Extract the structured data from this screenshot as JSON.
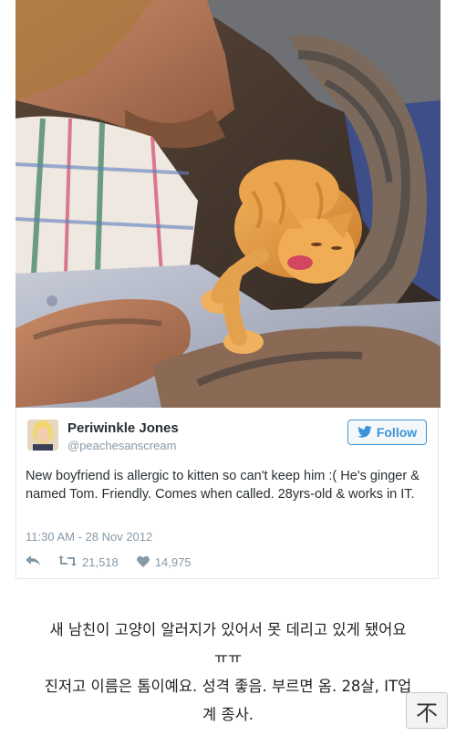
{
  "photo": {
    "icon": "photo-man-sleeping-with-kitten"
  },
  "tweet": {
    "display_name": "Periwinkle Jones",
    "handle": "@peachesanscream",
    "follow_label": "Follow",
    "text": "New boyfriend is allergic to kitten so can't keep him :( He's ginger & named Tom. Friendly. Comes when called. 28yrs-old & works in IT.",
    "timestamp": "11:30 AM - 28 Nov 2012",
    "retweets": "21,518",
    "likes": "14,975",
    "colors": {
      "twitter_blue": "#3b94d9",
      "muted": "#8899a6",
      "text": "#292f33"
    }
  },
  "caption": {
    "line1": "새 남친이 고양이 알러지가 있어서 못 데리고 있게 됐어요",
    "line2": "ㅠㅠ",
    "line3": "진저고 이름은 톰이예요. 성격 좋음. 부르면 옴. 28살, IT업",
    "line4": "계 종사."
  },
  "top_button": {
    "label": "不",
    "icon": "scroll-to-top-icon"
  }
}
